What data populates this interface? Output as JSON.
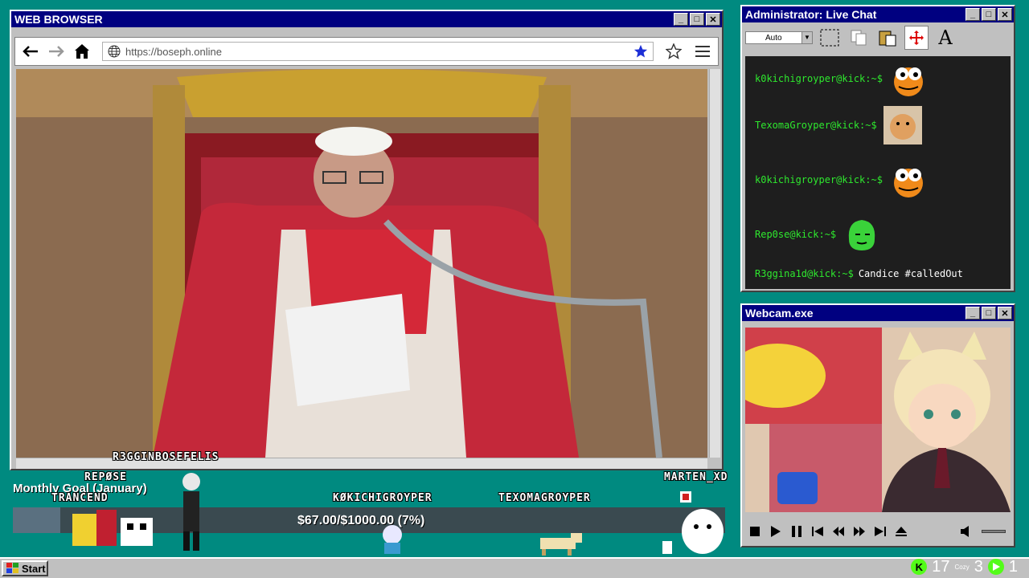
{
  "browser": {
    "title": "WEB BROWSER",
    "url_placeholder": "https://boseph.online"
  },
  "chat": {
    "title": "Administrator: Live Chat",
    "combo_value": "Auto",
    "messages": [
      {
        "user": "k0kichigroyper@kick:~$",
        "text": "",
        "emote": "frog-emote"
      },
      {
        "user": "TexomaGroyper@kick:~$",
        "text": "",
        "emote": "cat-emote"
      },
      {
        "user": "k0kichigroyper@kick:~$",
        "text": "",
        "emote": "frog-emote"
      },
      {
        "user": "Rep0se@kick:~$",
        "text": "",
        "emote": "green-blob-emote"
      },
      {
        "user": "R3ggina1d@kick:~$",
        "text": "Candice #calledOut",
        "emote": ""
      }
    ]
  },
  "webcam": {
    "title": "Webcam.exe"
  },
  "overlay": {
    "goal_label": "Monthly Goal (January)",
    "goal_text": "$67.00/$1000.00 (7%)",
    "goal_progress": 0.067,
    "tags": [
      "R3GGINBOSEFELIS",
      "REPØSE",
      "TRANCEND",
      "KØKICHIGROYPER",
      "TEXOMAGROYPER",
      "MARTEN_XD"
    ]
  },
  "taskbar": {
    "start_label": "Start",
    "tray_k": "K",
    "count_a": "17",
    "cozy": "Cozy",
    "count_b": "3",
    "count_c": "1"
  },
  "colors": {
    "desktop": "#008a80",
    "titlebar": "#000080",
    "chat_user": "#2ee82e",
    "kick_green": "#53fc18"
  }
}
